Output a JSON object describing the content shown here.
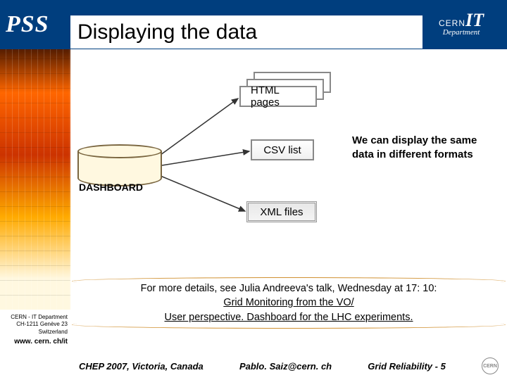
{
  "header": {
    "pss": "PSS",
    "title": "Displaying the data",
    "logo_cern": "CERN",
    "logo_it": "IT",
    "logo_dept": "Department"
  },
  "diagram": {
    "db_label": "DASHBOARD",
    "html_node": "HTML pages",
    "csv_node": "CSV list",
    "xml_node": "XML files",
    "side_text": "We can display the same data in different formats"
  },
  "banner": {
    "intro": "For more details, see Julia Andreeva's talk, Wednesday at 17: 10:",
    "link1": "Grid Monitoring from the VO/",
    "link2": "User perspective. Dashboard for the LHC experiments."
  },
  "strip": {
    "l1": "CERN - IT Department",
    "l2": "CH-1211 Genève 23",
    "l3": "Switzerland",
    "www": "www. cern. ch/it"
  },
  "footer": {
    "left": "CHEP 2007, Victoria, Canada",
    "mid": "Pablo. Saiz@cern. ch",
    "right": "Grid Reliability - 5"
  }
}
